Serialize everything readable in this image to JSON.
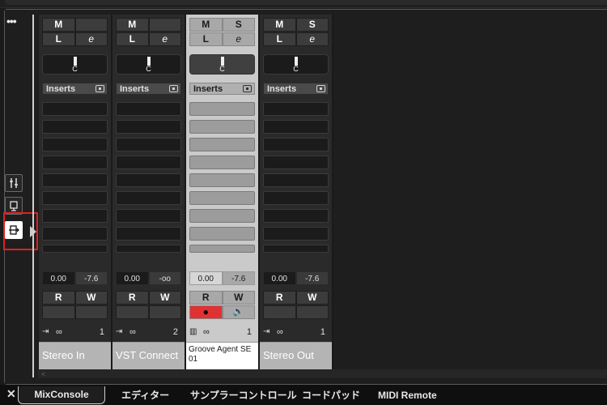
{
  "left_toolbar": {
    "more_label": "•••",
    "tools": [
      {
        "icon": "mixer-faders-icon"
      },
      {
        "icon": "device-panel-icon"
      },
      {
        "icon": "routing-panel-icon",
        "active": true
      }
    ]
  },
  "channels": [
    {
      "mute": "M",
      "solo": "",
      "listen": "L",
      "edit": "e",
      "pan": "C",
      "inserts_label": "Inserts",
      "volume": "0.00",
      "peak": "-7.6",
      "read": "R",
      "write": "W",
      "route_number": "1",
      "name": "Stereo In",
      "selected": false
    },
    {
      "mute": "M",
      "solo": "",
      "listen": "L",
      "edit": "e",
      "pan": "C",
      "inserts_label": "Inserts",
      "volume": "0.00",
      "peak": "-oo",
      "read": "R",
      "write": "W",
      "route_number": "2",
      "name": "VST Connect",
      "selected": false
    },
    {
      "mute": "M",
      "solo": "S",
      "listen": "L",
      "edit": "e",
      "pan": "C",
      "inserts_label": "Inserts",
      "volume": "0.00",
      "peak": "-7.6",
      "read": "R",
      "write": "W",
      "record": "●",
      "monitor": "🔈",
      "route_number": "1",
      "name": "Groove Agent SE 01",
      "selected": true
    },
    {
      "mute": "M",
      "solo": "S",
      "listen": "L",
      "edit": "e",
      "pan": "C",
      "inserts_label": "Inserts",
      "volume": "0.00",
      "peak": "-7.6",
      "read": "R",
      "write": "W",
      "route_number": "1",
      "name": "Stereo Out",
      "selected": false
    }
  ],
  "bottom_tabs": {
    "close_label": "✕",
    "tabs": [
      {
        "label": "MixConsole",
        "active": true
      },
      {
        "label": "エディター"
      },
      {
        "label": "サンプラーコントロール"
      },
      {
        "label": "コードパッド"
      },
      {
        "label": "MIDI Remote"
      }
    ]
  },
  "colors": {
    "record_active": "#e03232",
    "highlight": "#e02020",
    "selected_strip": "#cacaca"
  }
}
